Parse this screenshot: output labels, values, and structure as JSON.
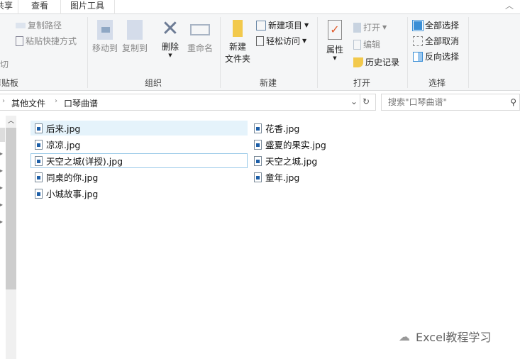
{
  "tabs": [
    "共享",
    "查看",
    "图片工具"
  ],
  "ribbon": {
    "clipboard": {
      "copy_path": "复制路径",
      "paste_shortcut": "粘贴快捷方式",
      "cut": "剪切",
      "label": "剪贴板"
    },
    "organize": {
      "move_to": "移动到",
      "copy_to": "复制到",
      "delete": "删除",
      "rename": "重命名",
      "label": "组织"
    },
    "new": {
      "new_folder": "新建\n文件夹",
      "new_item": "新建项目",
      "easy_access": "轻松访问",
      "label": "新建"
    },
    "open": {
      "properties": "属性",
      "open": "打开",
      "edit": "编辑",
      "history": "历史记录",
      "label": "打开"
    },
    "select": {
      "select_all": "全部选择",
      "select_none": "全部取消",
      "invert": "反向选择",
      "label": "选择"
    }
  },
  "breadcrumb": [
    "其他文件",
    "口琴曲谱"
  ],
  "search": {
    "placeholder": "搜索\"口琴曲谱\""
  },
  "files_col1": [
    "后来.jpg",
    "凉凉.jpg",
    "天空之城(详授).jpg",
    "同桌的你.jpg",
    "小城故事.jpg"
  ],
  "files_col2": [
    "花香.jpg",
    "盛夏的果实.jpg",
    "天空之城.jpg",
    "童年.jpg"
  ],
  "watermark": "Excel教程学习"
}
